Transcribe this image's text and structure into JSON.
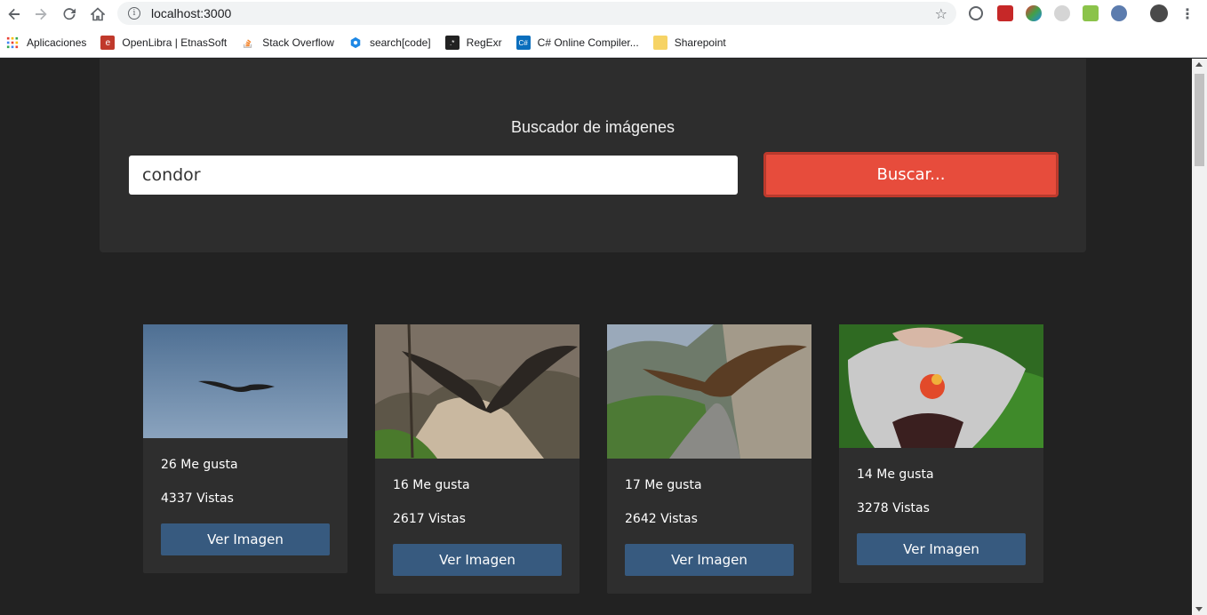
{
  "browser": {
    "url": "localhost:3000",
    "bookmarks": [
      {
        "label": "Aplicaciones",
        "icon": "apps-grid-icon",
        "color": "#e94235"
      },
      {
        "label": "OpenLibra | EtnasSoft",
        "icon": "openlibra-icon",
        "color": "#c0392b"
      },
      {
        "label": "Stack Overflow",
        "icon": "stackoverflow-icon",
        "color": "#f48024"
      },
      {
        "label": "search[code]",
        "icon": "searchcode-icon",
        "color": "#1e88e5"
      },
      {
        "label": "RegExr",
        "icon": "regexr-icon",
        "color": "#222222"
      },
      {
        "label": "C# Online Compiler...",
        "icon": "csharp-compiler-icon",
        "color": "#0a6ebd"
      },
      {
        "label": "Sharepoint",
        "icon": "folder-icon",
        "color": "#f6d365"
      }
    ]
  },
  "search": {
    "title": "Buscador de imágenes",
    "value": "condor",
    "button_label": "Buscar..."
  },
  "results": [
    {
      "likes": "26 Me gusta",
      "views": "4337 Vistas",
      "button": "Ver Imagen"
    },
    {
      "likes": "16 Me gusta",
      "views": "2617 Vistas",
      "button": "Ver Imagen"
    },
    {
      "likes": "17 Me gusta",
      "views": "2642 Vistas",
      "button": "Ver Imagen"
    },
    {
      "likes": "14 Me gusta",
      "views": "3278 Vistas",
      "button": "Ver Imagen"
    }
  ],
  "colors": {
    "page_bg": "#222222",
    "panel_bg": "#2d2d2d",
    "danger": "#e74c3c",
    "primary": "#375a7f"
  }
}
